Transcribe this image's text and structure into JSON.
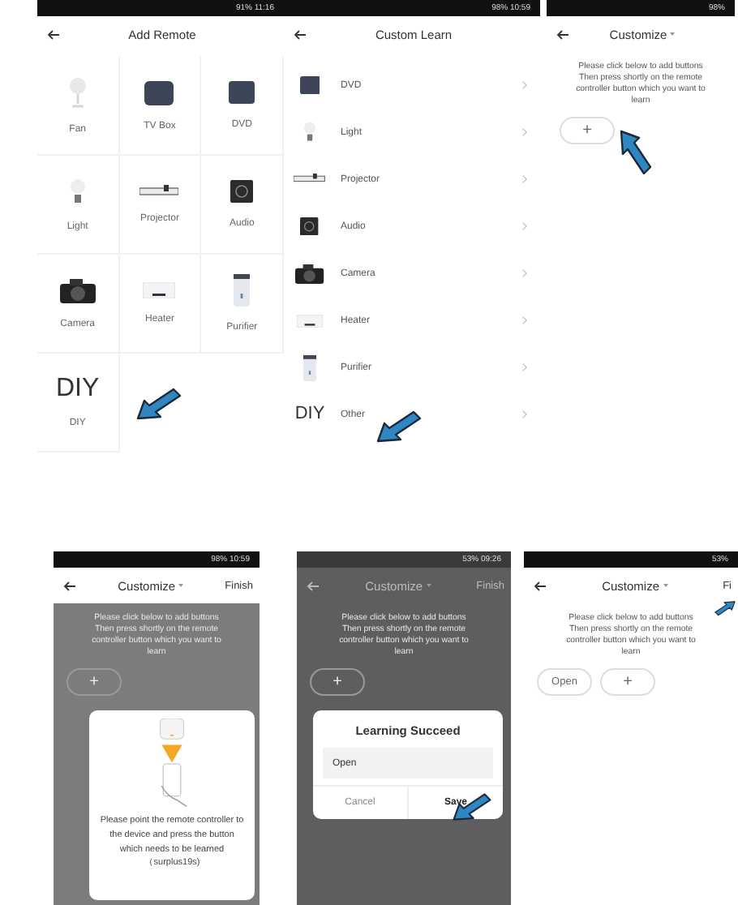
{
  "screens": [
    {
      "kind": "device_grid",
      "status": "91% 11:16",
      "title": "Add Remote",
      "pointer": true,
      "items": [
        {
          "kind": "fan",
          "label": "Fan"
        },
        {
          "kind": "tvbox",
          "label": "TV Box"
        },
        {
          "kind": "dvd",
          "label": "DVD"
        },
        {
          "kind": "light",
          "label": "Light"
        },
        {
          "kind": "projector",
          "label": "Projector"
        },
        {
          "kind": "audio",
          "label": "Audio"
        },
        {
          "kind": "camera",
          "label": "Camera"
        },
        {
          "kind": "heater",
          "label": "Heater"
        },
        {
          "kind": "purifier",
          "label": "Purifier"
        },
        {
          "kind": "diy",
          "label": "DIY",
          "icon_text": "DIY"
        }
      ]
    },
    {
      "kind": "device_list",
      "status": "98% 10:59",
      "title": "Custom Learn",
      "pointer": true,
      "items": [
        {
          "kind": "dvd",
          "label": "DVD"
        },
        {
          "kind": "light",
          "label": "Light"
        },
        {
          "kind": "projector",
          "label": "Projector"
        },
        {
          "kind": "audio",
          "label": "Audio"
        },
        {
          "kind": "camera",
          "label": "Camera"
        },
        {
          "kind": "heater",
          "label": "Heater"
        },
        {
          "kind": "purifier",
          "label": "Purifier"
        },
        {
          "kind": "diy",
          "label": "Other",
          "icon_text": "DIY"
        }
      ]
    },
    {
      "kind": "customize",
      "status": "98%",
      "title": "Customize",
      "pointer": true,
      "hint": "Please click below to add buttons Then press shortly on the remote controller button which you want to learn",
      "buttons": [
        {
          "kind": "add",
          "label": "+"
        }
      ]
    },
    {
      "kind": "customize",
      "status": "98% 10:59",
      "title": "Customize",
      "action": "Finish",
      "dimmed": true,
      "hint": "Please click below to add buttons Then press shortly on the remote controller button which you want to learn",
      "buttons": [
        {
          "kind": "add",
          "label": "+"
        }
      ],
      "dialog": {
        "kind": "learning",
        "message": "Please point the remote controller to the device and press the button which needs to be learned（surplus19s)"
      }
    },
    {
      "kind": "customize",
      "status": "53% 09:26",
      "title": "Customize",
      "action": "Finish",
      "dimmed": true,
      "pointer": true,
      "hint": "Please click below to add buttons Then press shortly on the remote controller button which you want to learn",
      "buttons": [
        {
          "kind": "add",
          "label": "+"
        }
      ],
      "dialog": {
        "kind": "result",
        "title": "Learning Succeed",
        "value": "Open",
        "cancel": "Cancel",
        "confirm": "Save"
      }
    },
    {
      "kind": "customize",
      "status": "53%",
      "title": "Customize",
      "action": "Fi",
      "pointer": true,
      "hint": "Please click below to add buttons Then press shortly on the remote controller button which you want to learn",
      "buttons": [
        {
          "kind": "saved",
          "label": "Open"
        },
        {
          "kind": "add",
          "label": "+"
        }
      ]
    }
  ]
}
